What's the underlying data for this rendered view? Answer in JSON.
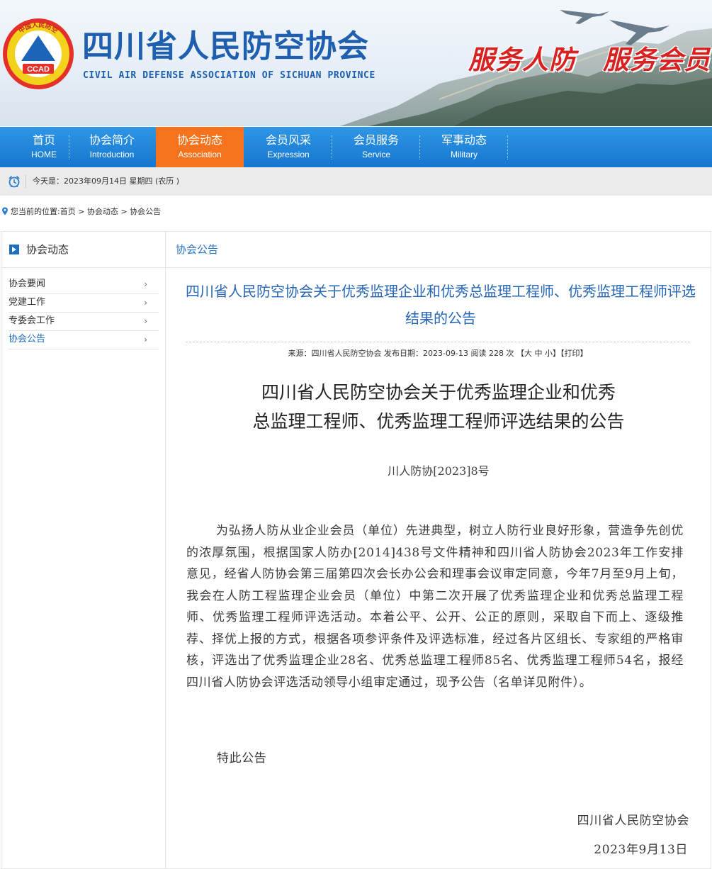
{
  "banner": {
    "logo_ring_text": "中国人民防空",
    "logo_badge": "CCAD",
    "site_title": "四川省人民防空协会",
    "site_title_en": "CIVIL AIR DEFENSE ASSOCIATION OF SICHUAN PROVINCE",
    "slogan": "服务人防　服务会员",
    "brand_blue": "#1f5fb0",
    "slogan_red": "#d82222"
  },
  "nav": {
    "items": [
      {
        "cn": "首页",
        "en": "HOME"
      },
      {
        "cn": "协会简介",
        "en": "Introduction"
      },
      {
        "cn": "协会动态",
        "en": "Association"
      },
      {
        "cn": "会员风采",
        "en": "Expression"
      },
      {
        "cn": "会员服务",
        "en": "Service"
      },
      {
        "cn": "军事动态",
        "en": "Military"
      }
    ],
    "active_index": 2,
    "bar_color": "#1b84d8",
    "active_color": "#f5731c"
  },
  "datebar": {
    "icon": "alarm-clock-icon",
    "text": "今天是：2023年09月14日 星期四 (农历 )"
  },
  "breadcrumb": {
    "icon": "location-pin-icon",
    "text": "您当前的位置:首页 > 协会动态 > 协会公告"
  },
  "sidebar": {
    "title": "协会动态",
    "items": [
      {
        "label": "协会要闻"
      },
      {
        "label": "党建工作"
      },
      {
        "label": "专委会工作"
      },
      {
        "label": "协会公告"
      }
    ],
    "active_index": 3,
    "chevron": "›"
  },
  "content": {
    "section_title": "协会公告",
    "article_title": "四川省人民防空协会关于优秀监理企业和优秀总监理工程师、优秀监理工程师评选结果的公告",
    "meta": {
      "source": "来源：四川省人民防空协会 发布日期：2023-09-13 阅读 228 次",
      "font_label": "【大 中 小】",
      "print_label": "【打印】"
    },
    "doc_title_line1": "四川省人民防空协会关于优秀监理企业和优秀",
    "doc_title_line2": "总监理工程师、优秀监理工程师评选结果的公告",
    "doc_no": "川人防协[2023]8号",
    "body": "为弘扬人防从业企业会员（单位）先进典型，树立人防行业良好形象，营造争先创优的浓厚氛围，根据国家人防办[2014]438号文件精神和四川省人防协会2023年工作安排意见，经省人防协会第三届第四次会长办公会和理事会议审定同意，今年7月至9月上旬，我会在人防工程监理企业会员（单位）中第二次开展了优秀监理企业和优秀总监理工程师、优秀监理工程师评选活动。本着公平、公开、公正的原则，采取自下而上、逐级推荐、择优上报的方式，根据各项参评条件及评选标准，经过各片区组长、专家组的严格审核，评选出了优秀监理企业28名、优秀总监理工程师85名、优秀监理工程师54名，报经四川省人防协会评选活动领导小组审定通过，现予公告（名单详见附件）。",
    "special": "特此公告",
    "signature": "四川省人民防空协会",
    "date": "2023年9月13日",
    "link_color": "#2666b8"
  }
}
